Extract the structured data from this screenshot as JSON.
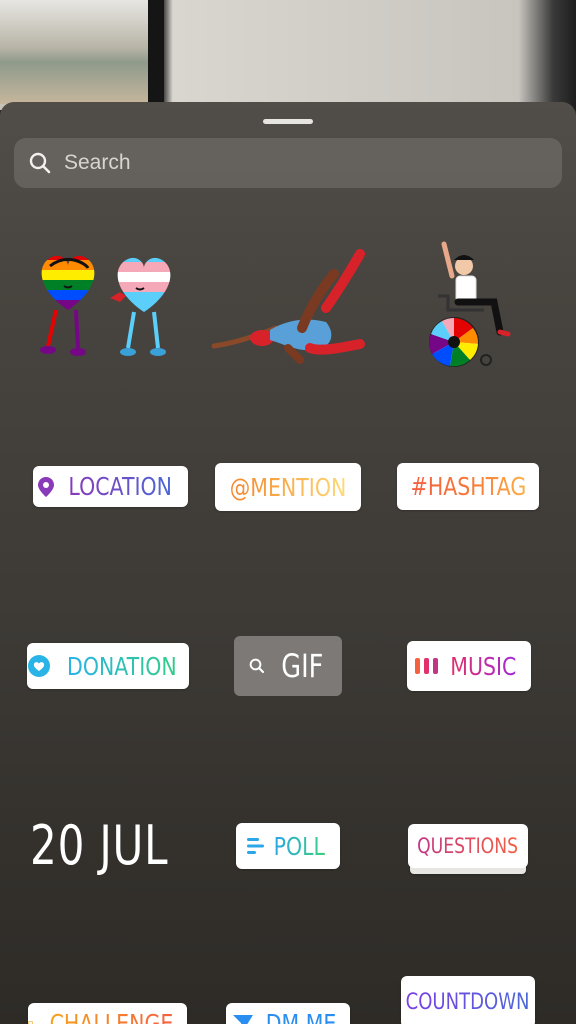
{
  "search": {
    "placeholder": "Search"
  },
  "stickers": {
    "location": "LOCATION",
    "mention": "@MENTION",
    "hashtag": "#HASHTAG",
    "donation": "DONATION",
    "gif": "GIF",
    "music": "MUSIC",
    "date": "20 JUL",
    "poll": "POLL",
    "questions": "QUESTIONS",
    "challenge": "CHALLENGE",
    "dm_me": "DM ME",
    "countdown": "COUNTDOWN"
  },
  "icons": {
    "search": "search-icon",
    "location": "location-pin-icon",
    "donation": "heart-circle-icon",
    "gif": "search-icon",
    "music": "equalizer-icon",
    "poll": "poll-bars-icon",
    "dm": "send-icon",
    "challenge": "challenge-icon"
  },
  "colors": {
    "sheet": "#48443f",
    "pill_bg": "#ffffff",
    "gif_bg": "#7c7976"
  }
}
